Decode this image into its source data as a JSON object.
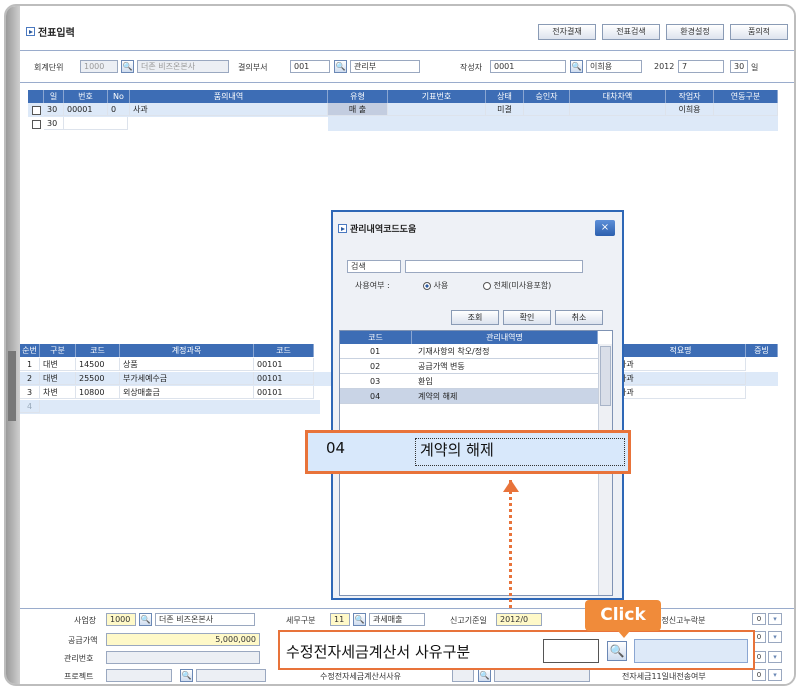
{
  "window": {
    "title": "전표입력",
    "toolbar": [
      "전자결재",
      "전표검색",
      "환경설정",
      "품의적"
    ]
  },
  "filter": {
    "unit_label": "회계단위",
    "unit_code": "1000",
    "unit_name": "더존 비즈온본사",
    "dept_label": "결의부서",
    "dept_code": "001",
    "dept_name": "관리부",
    "writer_label": "작성자",
    "writer_code": "0001",
    "writer_name": "이희용",
    "year": "2012",
    "month": "7",
    "day": "30",
    "day_unit": "일"
  },
  "top_grid": {
    "headers": [
      "",
      "일",
      "번호",
      "No",
      "품의내역",
      "유형",
      "기표번호",
      "상태",
      "승인자",
      "대차차액",
      "작업자",
      "연동구분"
    ],
    "rows": [
      [
        "",
        "30",
        "00001",
        "0",
        "사과",
        "매 출",
        "",
        "미결",
        "",
        "",
        "이희용",
        ""
      ],
      [
        "",
        "30",
        "",
        "",
        "",
        "",
        "",
        "",
        "",
        "",
        "",
        ""
      ]
    ]
  },
  "bottom_grid": {
    "headers": [
      "순번",
      "구분",
      "코드",
      "계정과목",
      "코드",
      "적요명",
      "증빙"
    ],
    "rows": [
      [
        "1",
        "대변",
        "14500",
        "상품",
        "00101",
        "사과",
        ""
      ],
      [
        "2",
        "대변",
        "25500",
        "부가세예수금",
        "00101",
        "사과",
        ""
      ],
      [
        "3",
        "차변",
        "10800",
        "외상매출금",
        "00101",
        "사과",
        ""
      ],
      [
        "4",
        "",
        "",
        "",
        "",
        "",
        ""
      ]
    ]
  },
  "popup": {
    "title": "관리내역코드도움",
    "close": "×",
    "search_select": "검색",
    "use_label": "사용여부 :",
    "radio_use": "사용",
    "radio_all": "전체(미사용포함)",
    "buttons": [
      "조회",
      "확인",
      "취소"
    ],
    "col_code": "코드",
    "col_name": "관리내역명",
    "items": [
      {
        "code": "01",
        "name": "기재사항의 착오/정정"
      },
      {
        "code": "02",
        "name": "공급가액 변동"
      },
      {
        "code": "03",
        "name": "환입"
      },
      {
        "code": "04",
        "name": "계약의 해제"
      }
    ]
  },
  "zoom": {
    "code": "04",
    "name": "계약의 해제"
  },
  "callout": {
    "click": "Click"
  },
  "bottom_form": {
    "site_label": "사업장",
    "site_code": "1000",
    "site_name": "더존 비즈온본사",
    "tax_label": "세무구분",
    "tax_code": "11",
    "tax_name": "과세매출",
    "date_label": "신고기준일",
    "date_value": "2012/0",
    "supply_label": "공급가액",
    "supply_value": "5,000,000",
    "mgmt_label": "관리번호",
    "project_label": "프로젝트",
    "reason_small": "수정전자세금계산서사유",
    "reason_big": "수정전자세금계산서 사유구분",
    "right1": "예정신고누락분",
    "right2": "전자세금11일내전송여부",
    "flag": "0"
  }
}
